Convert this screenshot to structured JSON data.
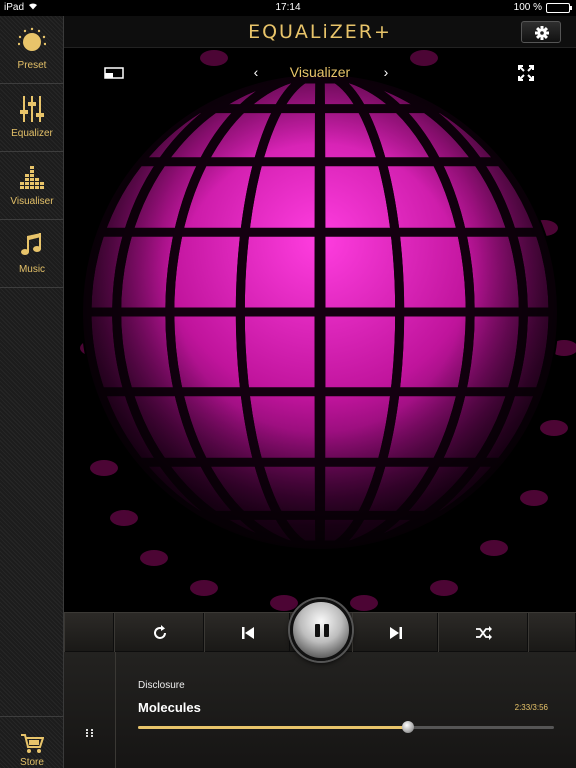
{
  "status_bar": {
    "device": "iPad",
    "time": "17:14",
    "battery_text": "100 %"
  },
  "app": {
    "title": "EQUALiZER+"
  },
  "sidebar": {
    "items": [
      {
        "label": "Preset",
        "icon": "preset-icon"
      },
      {
        "label": "Equalizer",
        "icon": "equalizer-sliders-icon"
      },
      {
        "label": "Visualiser",
        "icon": "visualiser-bars-icon"
      },
      {
        "label": "Music",
        "icon": "music-note-icon"
      }
    ],
    "store_label": "Store",
    "store_icon": "cart-icon"
  },
  "visualizer": {
    "title": "Visualizer",
    "prev": "‹",
    "next": "›"
  },
  "transport": {
    "controls": [
      "repeat-icon",
      "previous-track-icon",
      "pause-icon",
      "next-track-icon",
      "shuffle-icon"
    ]
  },
  "now_playing": {
    "artist": "Disclosure",
    "track": "Molecules",
    "time": "2:33/3:56",
    "progress": 0.649
  },
  "colors": {
    "accent": "#e8c46a",
    "ball": "#ff1fd0",
    "background": "#000000"
  }
}
